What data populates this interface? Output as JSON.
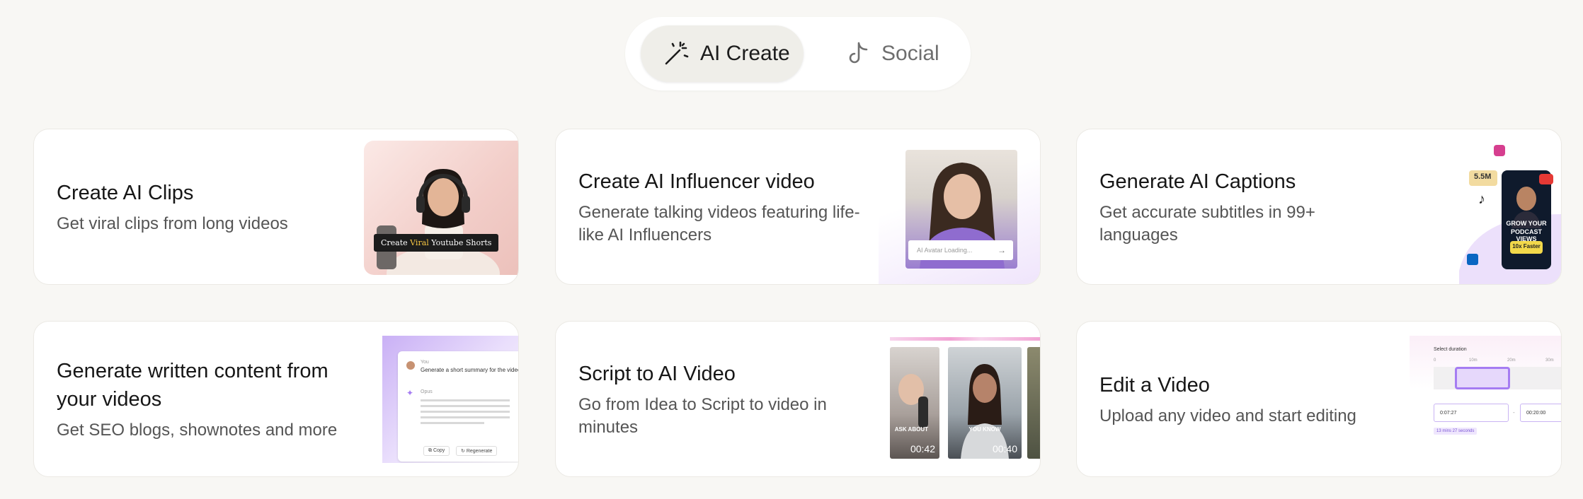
{
  "tabs": [
    {
      "label": "AI Create",
      "icon": "magic-wand-icon",
      "active": true
    },
    {
      "label": "Social",
      "icon": "tiktok-icon",
      "active": false
    }
  ],
  "cards": [
    {
      "title": "Create AI Clips",
      "desc": "Get viral clips from long videos",
      "thumb": {
        "caption_prefix": "Create ",
        "caption_highlight": "Viral",
        "caption_suffix": " Youtube Shorts"
      }
    },
    {
      "title": "Create AI Influencer video",
      "desc_line1": "Generate talking videos featuring life-",
      "desc_line2": "like AI Influencers",
      "thumb": {
        "input_placeholder": "AI Avatar Loading..."
      }
    },
    {
      "title": "Generate AI Captions",
      "desc_line1": "Get accurate subtitles in 99+",
      "desc_line2": "languages",
      "thumb": {
        "stat": "5.5M",
        "poster_line1": "GROW YOUR",
        "poster_line2": "PODCAST VIEWS",
        "badge": "10x Faster"
      }
    },
    {
      "title_line1": "Generate written content from",
      "title_line2": "your videos",
      "desc": "Get SEO blogs, shownotes and more",
      "thumb": {
        "user": "You",
        "prompt": "Generate a short summary for the video",
        "assistant": "Opus",
        "copy": "Copy",
        "regenerate": "Regenerate"
      }
    },
    {
      "title": "Script to AI Video",
      "desc_line1": "Go from Idea to Script to video in",
      "desc_line2": "minutes",
      "thumb": {
        "clip1_caption": "ASK ABOUT",
        "clip1_time": "00:42",
        "clip2_caption": "YOU KNOW",
        "clip2_time": "00:40"
      }
    },
    {
      "title": "Edit a Video",
      "desc": "Upload any video and start editing",
      "thumb": {
        "heading": "Select duration",
        "ticks": [
          "0",
          "10m",
          "20m",
          "30m"
        ],
        "start": "0:07:27",
        "end": "00:20:00",
        "total": "13 mins 27 seconds"
      }
    }
  ],
  "colors": {
    "background": "#f8f7f4",
    "card": "#ffffff",
    "accent_purple": "#a57cf2",
    "highlight_yellow": "#f5c542"
  }
}
